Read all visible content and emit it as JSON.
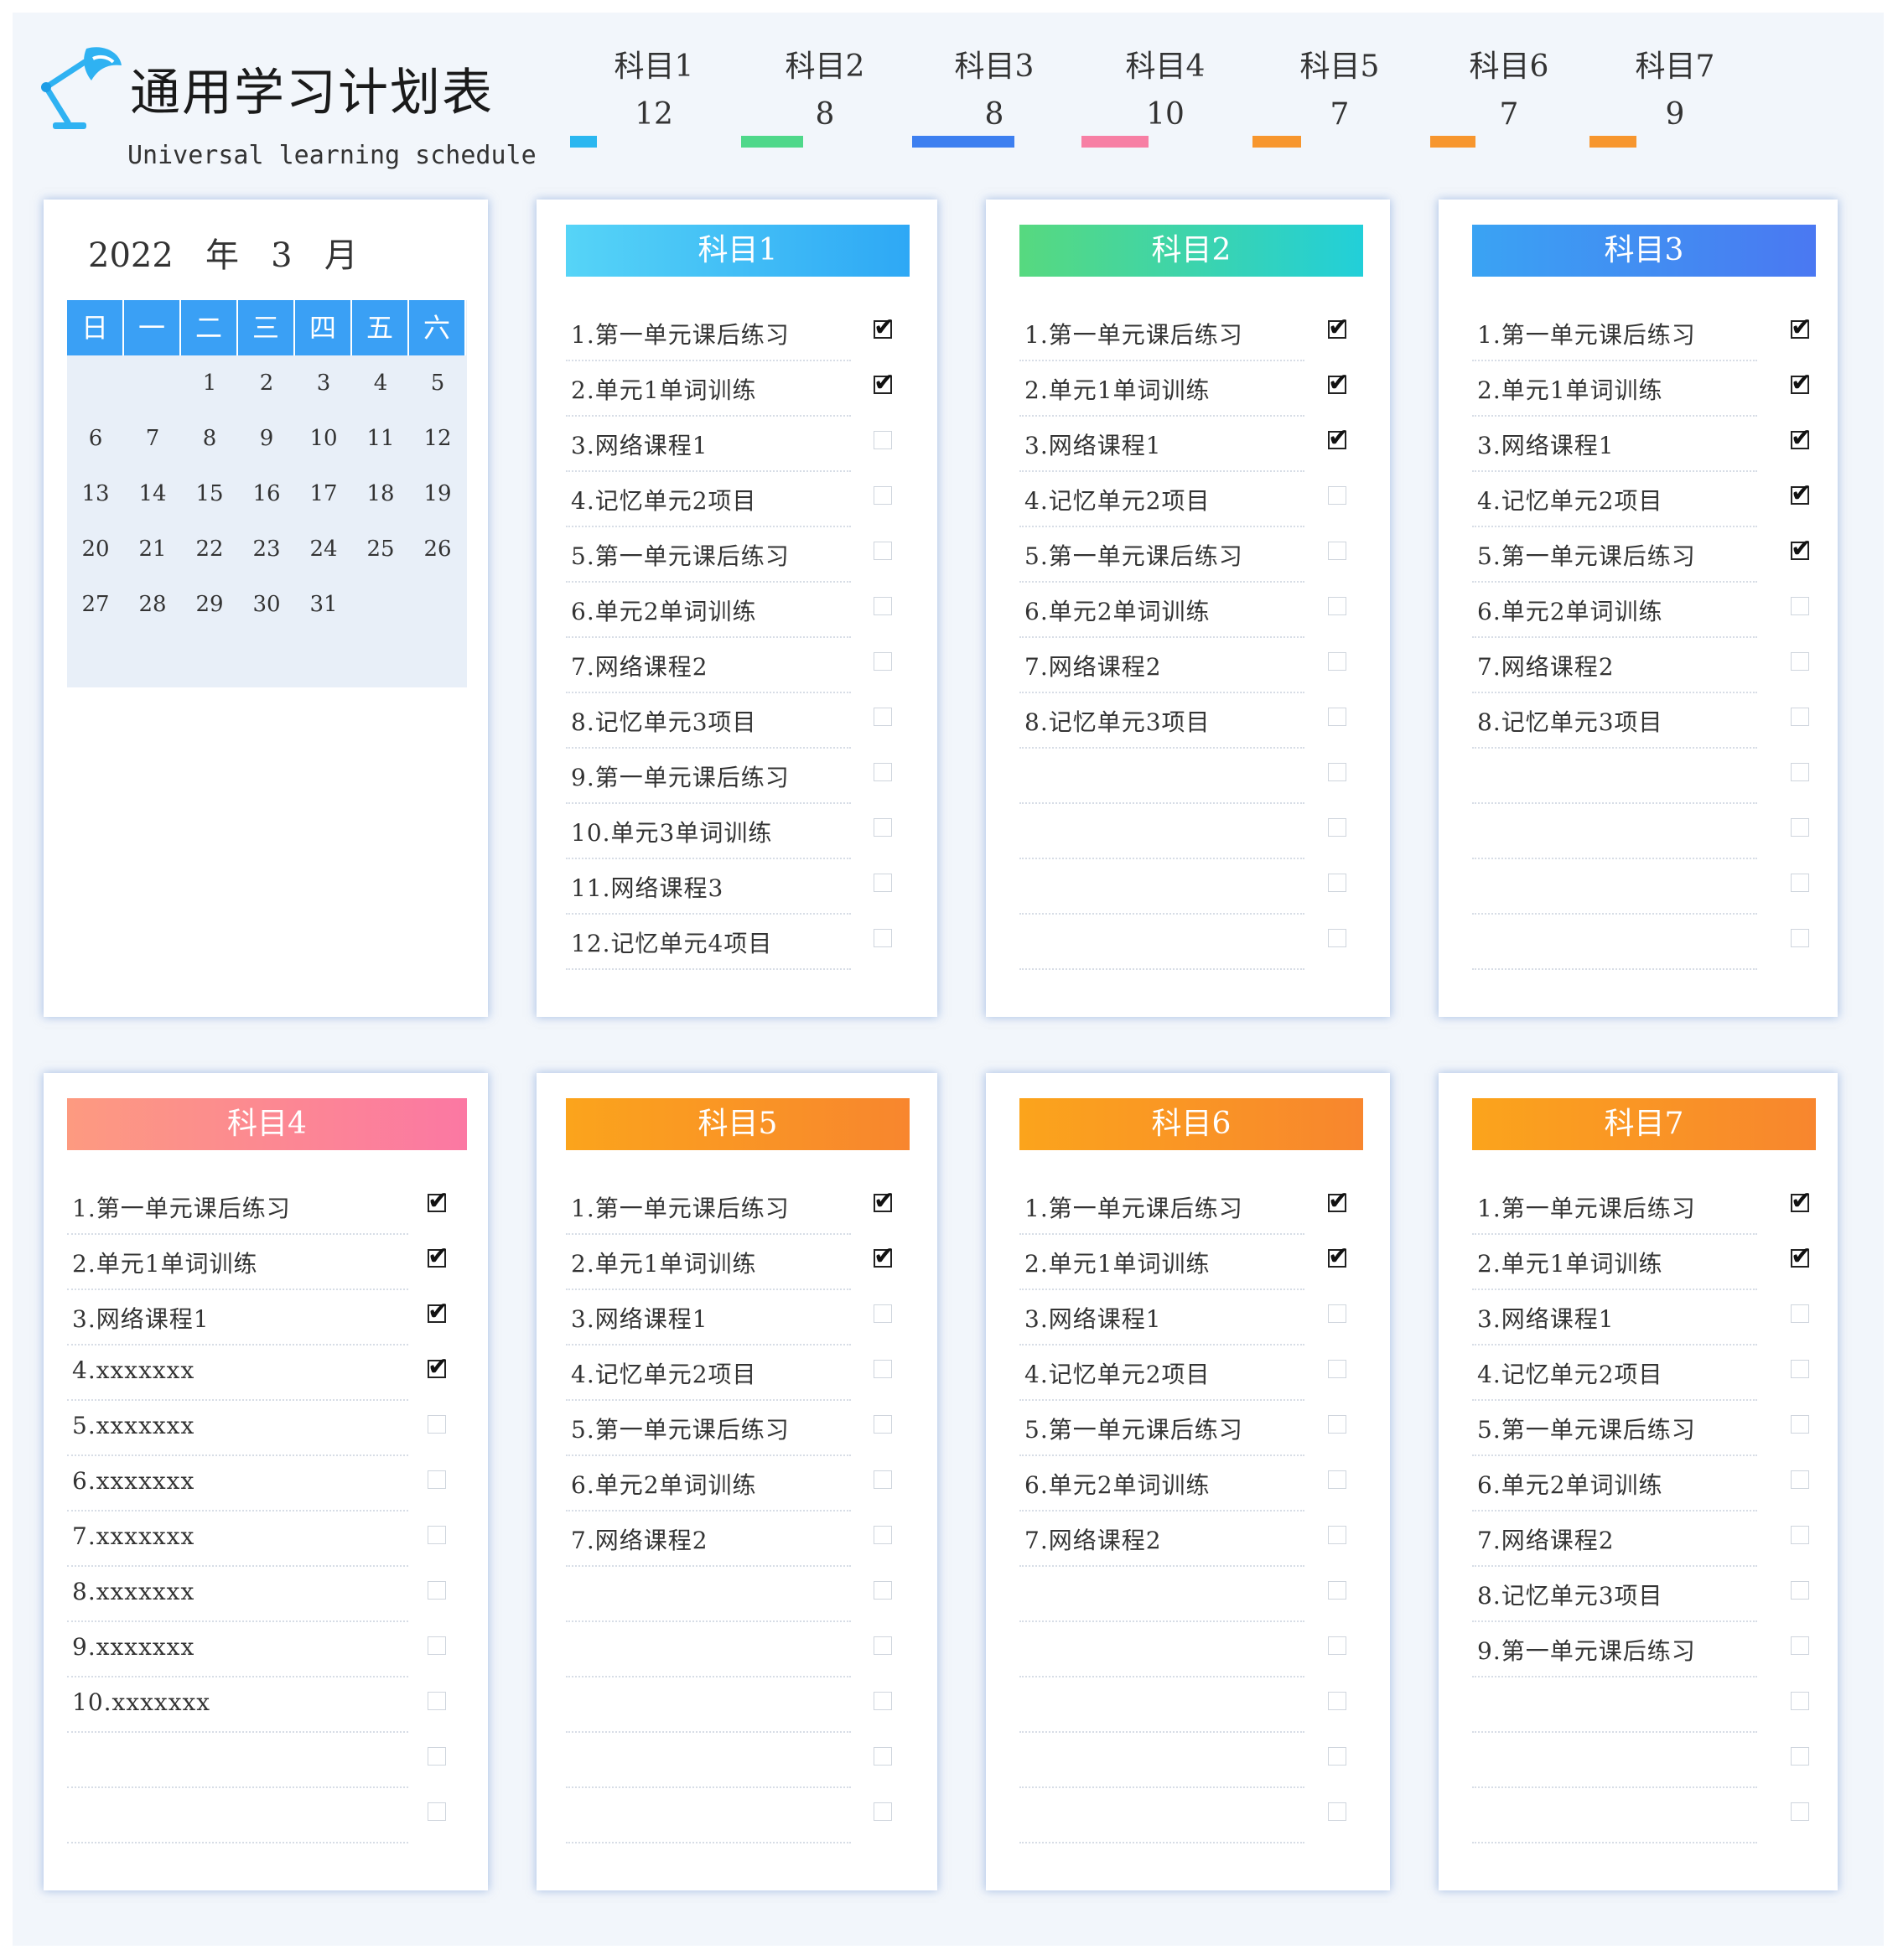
{
  "header": {
    "title": "通用学习计划表",
    "subtitle": "Universal learning schedule"
  },
  "summary": [
    {
      "name": "科目1",
      "count": "12",
      "color": "#2bb7f0"
    },
    {
      "name": "科目2",
      "count": "8",
      "color": "#4fd88a"
    },
    {
      "name": "科目3",
      "count": "8",
      "color": "#3d7ff0"
    },
    {
      "name": "科目4",
      "count": "10",
      "color": "#f77fa4"
    },
    {
      "name": "科目5",
      "count": "7",
      "color": "#f7962e"
    },
    {
      "name": "科目6",
      "count": "7",
      "color": "#f7962e"
    },
    {
      "name": "科目7",
      "count": "9",
      "color": "#f7962e"
    }
  ],
  "calendar": {
    "year": "2022",
    "year_label": "年",
    "month": "3",
    "month_label": "月",
    "weekdays": [
      "日",
      "一",
      "二",
      "三",
      "四",
      "五",
      "六"
    ],
    "weeks": [
      [
        "",
        "",
        "1",
        "2",
        "3",
        "4",
        "5"
      ],
      [
        "6",
        "7",
        "8",
        "9",
        "10",
        "11",
        "12"
      ],
      [
        "13",
        "14",
        "15",
        "16",
        "17",
        "18",
        "19"
      ],
      [
        "20",
        "21",
        "22",
        "23",
        "24",
        "25",
        "26"
      ],
      [
        "27",
        "28",
        "29",
        "30",
        "31",
        "",
        ""
      ]
    ]
  },
  "subjects": [
    {
      "title": "科目1",
      "gradient": [
        "#56d4f7",
        "#2ea8f5"
      ],
      "tasks": [
        {
          "label": "1.第一单元课后练习",
          "done": true
        },
        {
          "label": "2.单元1单词训练",
          "done": true
        },
        {
          "label": "3.网络课程1",
          "done": false
        },
        {
          "label": "4.记忆单元2项目",
          "done": false
        },
        {
          "label": "5.第一单元课后练习",
          "done": false
        },
        {
          "label": "6.单元2单词训练",
          "done": false
        },
        {
          "label": "7.网络课程2",
          "done": false
        },
        {
          "label": "8.记忆单元3项目",
          "done": false
        },
        {
          "label": "9.第一单元课后练习",
          "done": false
        },
        {
          "label": "10.单元3单词训练",
          "done": false
        },
        {
          "label": "11.网络课程3",
          "done": false
        },
        {
          "label": "12.记忆单元4项目",
          "done": false
        }
      ]
    },
    {
      "title": "科目2",
      "gradient": [
        "#57d97f",
        "#22cfd9"
      ],
      "tasks": [
        {
          "label": "1.第一单元课后练习",
          "done": true
        },
        {
          "label": "2.单元1单词训练",
          "done": true
        },
        {
          "label": "3.网络课程1",
          "done": true
        },
        {
          "label": "4.记忆单元2项目",
          "done": false
        },
        {
          "label": "5.第一单元课后练习",
          "done": false
        },
        {
          "label": "6.单元2单词训练",
          "done": false
        },
        {
          "label": "7.网络课程2",
          "done": false
        },
        {
          "label": "8.记忆单元3项目",
          "done": false
        },
        {
          "label": "",
          "done": false
        },
        {
          "label": "",
          "done": false
        },
        {
          "label": "",
          "done": false
        },
        {
          "label": "",
          "done": false
        }
      ]
    },
    {
      "title": "科目3",
      "gradient": [
        "#3aa3f3",
        "#4a78f2"
      ],
      "tasks": [
        {
          "label": "1.第一单元课后练习",
          "done": true
        },
        {
          "label": "2.单元1单词训练",
          "done": true
        },
        {
          "label": "3.网络课程1",
          "done": true
        },
        {
          "label": "4.记忆单元2项目",
          "done": true
        },
        {
          "label": "5.第一单元课后练习",
          "done": true
        },
        {
          "label": "6.单元2单词训练",
          "done": false
        },
        {
          "label": "7.网络课程2",
          "done": false
        },
        {
          "label": "8.记忆单元3项目",
          "done": false
        },
        {
          "label": "",
          "done": false
        },
        {
          "label": "",
          "done": false
        },
        {
          "label": "",
          "done": false
        },
        {
          "label": "",
          "done": false
        }
      ]
    },
    {
      "title": "科目4",
      "gradient": [
        "#fd9a80",
        "#fb78a3"
      ],
      "tasks": [
        {
          "label": "1.第一单元课后练习",
          "done": true
        },
        {
          "label": "2.单元1单词训练",
          "done": true
        },
        {
          "label": "3.网络课程1",
          "done": true
        },
        {
          "label": "4.xxxxxxx",
          "done": true
        },
        {
          "label": "5.xxxxxxx",
          "done": false
        },
        {
          "label": "6.xxxxxxx",
          "done": false
        },
        {
          "label": "7.xxxxxxx",
          "done": false
        },
        {
          "label": "8.xxxxxxx",
          "done": false
        },
        {
          "label": "9.xxxxxxx",
          "done": false
        },
        {
          "label": "10.xxxxxxx",
          "done": false
        },
        {
          "label": "",
          "done": false
        },
        {
          "label": "",
          "done": false
        }
      ]
    },
    {
      "title": "科目5",
      "gradient": [
        "#fba41c",
        "#f8862e"
      ],
      "tasks": [
        {
          "label": "1.第一单元课后练习",
          "done": true
        },
        {
          "label": "2.单元1单词训练",
          "done": true
        },
        {
          "label": "3.网络课程1",
          "done": false
        },
        {
          "label": "4.记忆单元2项目",
          "done": false
        },
        {
          "label": "5.第一单元课后练习",
          "done": false
        },
        {
          "label": "6.单元2单词训练",
          "done": false
        },
        {
          "label": "7.网络课程2",
          "done": false
        },
        {
          "label": "",
          "done": false
        },
        {
          "label": "",
          "done": false
        },
        {
          "label": "",
          "done": false
        },
        {
          "label": "",
          "done": false
        },
        {
          "label": "",
          "done": false
        }
      ]
    },
    {
      "title": "科目6",
      "gradient": [
        "#fba41c",
        "#f8862e"
      ],
      "tasks": [
        {
          "label": "1.第一单元课后练习",
          "done": true
        },
        {
          "label": "2.单元1单词训练",
          "done": true
        },
        {
          "label": "3.网络课程1",
          "done": false
        },
        {
          "label": "4.记忆单元2项目",
          "done": false
        },
        {
          "label": "5.第一单元课后练习",
          "done": false
        },
        {
          "label": "6.单元2单词训练",
          "done": false
        },
        {
          "label": "7.网络课程2",
          "done": false
        },
        {
          "label": "",
          "done": false
        },
        {
          "label": "",
          "done": false
        },
        {
          "label": "",
          "done": false
        },
        {
          "label": "",
          "done": false
        },
        {
          "label": "",
          "done": false
        }
      ]
    },
    {
      "title": "科目7",
      "gradient": [
        "#fba41c",
        "#f8862e"
      ],
      "tasks": [
        {
          "label": "1.第一单元课后练习",
          "done": true
        },
        {
          "label": "2.单元1单词训练",
          "done": true
        },
        {
          "label": "3.网络课程1",
          "done": false
        },
        {
          "label": "4.记忆单元2项目",
          "done": false
        },
        {
          "label": "5.第一单元课后练习",
          "done": false
        },
        {
          "label": "6.单元2单词训练",
          "done": false
        },
        {
          "label": "7.网络课程2",
          "done": false
        },
        {
          "label": "8.记忆单元3项目",
          "done": false
        },
        {
          "label": "9.第一单元课后练习",
          "done": false
        },
        {
          "label": "",
          "done": false
        },
        {
          "label": "",
          "done": false
        },
        {
          "label": "",
          "done": false
        }
      ]
    }
  ]
}
